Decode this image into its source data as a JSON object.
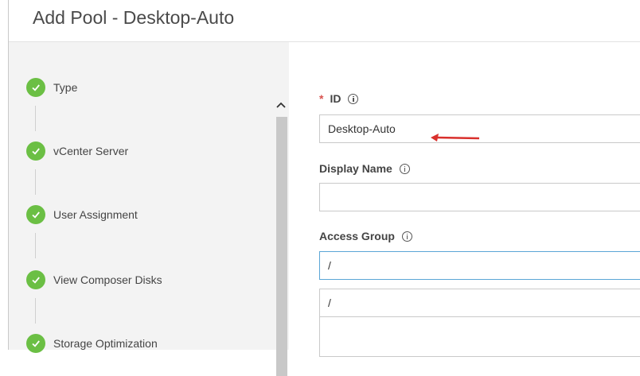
{
  "dialog": {
    "title": "Add Pool - Desktop-Auto"
  },
  "steps": [
    {
      "label": "Type",
      "status": "complete"
    },
    {
      "label": "vCenter Server",
      "status": "complete"
    },
    {
      "label": "User Assignment",
      "status": "complete"
    },
    {
      "label": "View Composer Disks",
      "status": "complete"
    },
    {
      "label": "Storage Optimization",
      "status": "complete"
    }
  ],
  "form": {
    "id": {
      "label": "ID",
      "required_mark": "*",
      "value": "Desktop-Auto"
    },
    "display_name": {
      "label": "Display Name",
      "value": ""
    },
    "access_group": {
      "label": "Access Group",
      "value": "/",
      "dropdown_options": [
        "/"
      ]
    }
  },
  "colors": {
    "check": "#6bbf44",
    "required": "#d9534f",
    "arrow": "#d9302c",
    "focus": "#5aa6d6"
  }
}
